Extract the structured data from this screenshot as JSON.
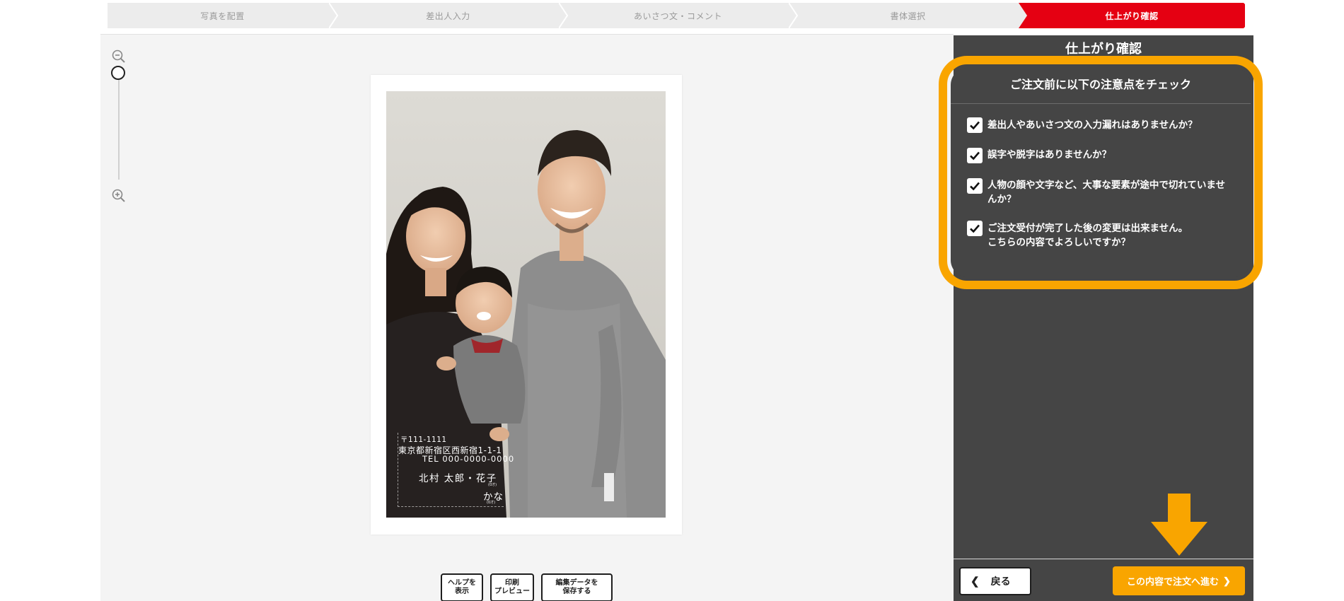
{
  "steps": [
    {
      "label": "写真を配置",
      "active": false
    },
    {
      "label": "差出人入力",
      "active": false
    },
    {
      "label": "あいさつ文・コメント",
      "active": false
    },
    {
      "label": "書体選択",
      "active": false
    },
    {
      "label": "仕上がり確認",
      "active": true
    }
  ],
  "colors": {
    "step_inactive": "#ececec",
    "step_active": "#e50012",
    "panel_bg": "#454545",
    "accent_orange": "#f9a500",
    "canvas_bg": "#f4f4f4"
  },
  "zoom": {
    "out_icon": "zoom-out-icon",
    "in_icon": "zoom-in-icon",
    "level": 0
  },
  "card": {
    "address": {
      "postal": "〒111-1111",
      "line": "東京都新宿区西新宿1-1-1",
      "tel": "TEL 000-0000-0000",
      "name": "北村 太郎・花子",
      "furigana_small": "(0才)",
      "kana": "かな",
      "kana_small": "(0才)"
    }
  },
  "toolbar": {
    "help_label": "ヘルプを\n表示",
    "print_label": "印刷\nプレビュー",
    "save_label": "編集データを\n保存する"
  },
  "panel": {
    "title": "仕上がり確認",
    "check_heading": "ご注文前に以下の注意点をチェック",
    "checks": [
      {
        "text": "差出人やあいさつ文の入力漏れはありませんか？",
        "checked": true
      },
      {
        "text": "誤字や脱字はありませんか？",
        "checked": true
      },
      {
        "text": "人物の顔や文字など、大事な要素が途中で切れていませ\nんか？",
        "checked": true
      },
      {
        "text": "ご注文受付が完了した後の変更は出来ません。\nこちらの内容でよろしいですか？",
        "checked": true
      }
    ],
    "back_label": "戻る",
    "next_label": "この内容で注文へ進む"
  }
}
